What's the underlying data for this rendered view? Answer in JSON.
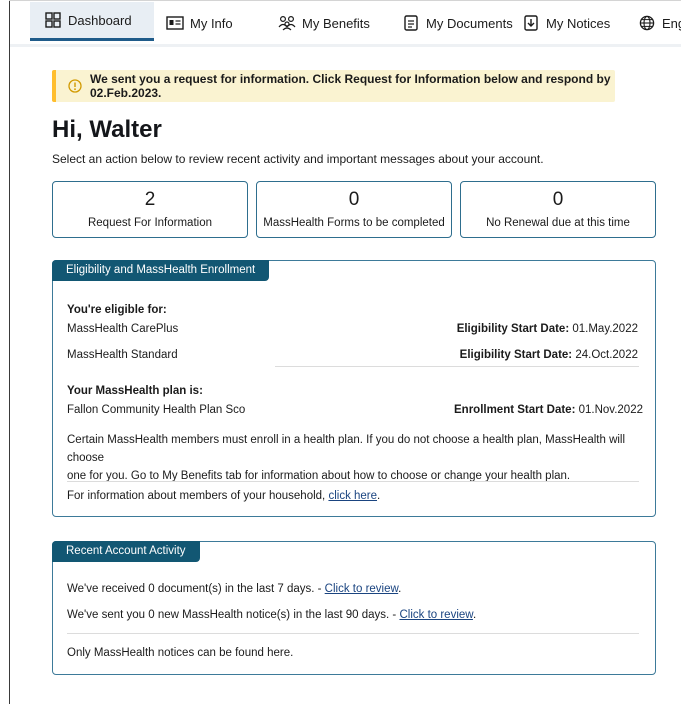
{
  "nav": {
    "tabs": [
      {
        "label": "Dashboard",
        "icon": "dashboard-grid-icon"
      },
      {
        "label": "My Info",
        "icon": "id-card-icon"
      },
      {
        "label": "My Benefits",
        "icon": "people-icon"
      },
      {
        "label": "My Documents",
        "icon": "document-icon"
      },
      {
        "label": "My Notices",
        "icon": "download-notice-icon"
      },
      {
        "label": "Engl",
        "icon": "globe-icon"
      }
    ]
  },
  "alert": {
    "text": "We sent you a request for information. Click Request for Information below and respond by 02.Feb.2023.",
    "icon": "warning-circle-icon"
  },
  "greeting": "Hi, Walter",
  "subtitle": "Select an action below to review recent activity and important messages about your account.",
  "cards": [
    {
      "count": "2",
      "label": "Request For Information"
    },
    {
      "count": "0",
      "label": "MassHealth Forms to be completed"
    },
    {
      "count": "0",
      "label": "No Renewal due at this time"
    }
  ],
  "eligibility": {
    "title": "Eligibility and MassHealth Enrollment",
    "eligible_heading": "You're eligible for:",
    "programs": [
      {
        "name": "MassHealth CarePlus",
        "date_label": "Eligibility Start Date:",
        "date": "01.May.2022"
      },
      {
        "name": "MassHealth Standard",
        "date_label": "Eligibility Start Date:",
        "date": "24.Oct.2022"
      }
    ],
    "plan_heading": "Your MassHealth plan is:",
    "plan": {
      "name": "Fallon Community Health Plan Sco",
      "date_label": "Enrollment Start Date:",
      "date": "01.Nov.2022"
    },
    "notice_line1": "Certain MassHealth members must enroll in a health plan. If you do not choose a health plan, MassHealth will choose",
    "notice_line2": "one for you. Go to My Benefits tab for information about how to choose or change your health plan.",
    "household_text": "For information about members of your household,",
    "household_link": "click here",
    "household_end": "."
  },
  "activity": {
    "title": "Recent Account Activity",
    "docs_text": "We've received 0 document(s) in the last 7 days. -",
    "docs_link": "Click to review",
    "docs_end": ".",
    "notices_text": "We've sent you 0 new MassHealth notice(s) in the last 90 days. -",
    "notices_link": "Click to review",
    "notices_end": ".",
    "footer": "Only MassHealth notices can be found here."
  }
}
